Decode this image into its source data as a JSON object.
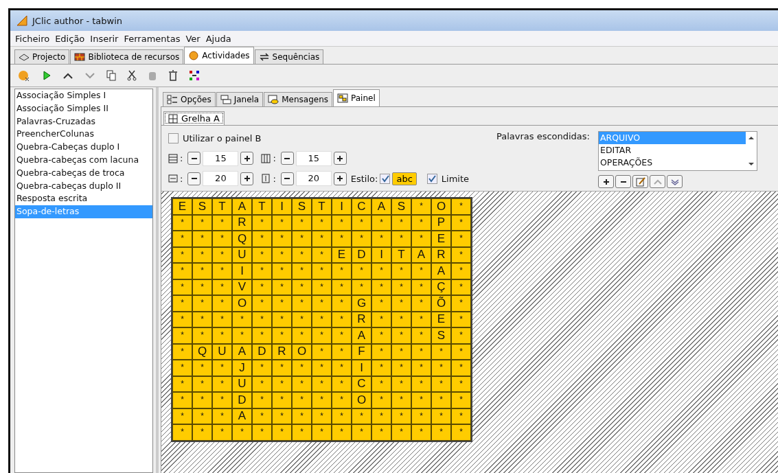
{
  "window": {
    "title": "JClic author - tabwin"
  },
  "menu": [
    "Ficheiro",
    "Edição",
    "Inserir",
    "Ferramentas",
    "Ver",
    "Ajuda"
  ],
  "tabs": [
    {
      "label": "Projecto",
      "selected": false
    },
    {
      "label": "Biblioteca de recursos",
      "selected": false
    },
    {
      "label": "Actividades",
      "selected": true
    },
    {
      "label": "Sequências",
      "selected": false
    }
  ],
  "activities": [
    {
      "label": "Associação Simples I",
      "selected": false
    },
    {
      "label": "Associação Simples II",
      "selected": false
    },
    {
      "label": "Palavras-Cruzadas",
      "selected": false
    },
    {
      "label": "PreencherColunas",
      "selected": false
    },
    {
      "label": "Quebra-Cabeças duplo I",
      "selected": false
    },
    {
      "label": "Quebra-cabeças com lacuna",
      "selected": false
    },
    {
      "label": "Quebra-cabeças de troca",
      "selected": false
    },
    {
      "label": "Quebra-cabeças duplo II",
      "selected": false
    },
    {
      "label": "Resposta escrita",
      "selected": false
    },
    {
      "label": "Sopa-de-letras",
      "selected": true
    }
  ],
  "editor_tabs": [
    {
      "label": "Opções",
      "selected": false
    },
    {
      "label": "Janela",
      "selected": false
    },
    {
      "label": "Mensagens",
      "selected": false
    },
    {
      "label": "Painel",
      "selected": true
    }
  ],
  "panel_tabs": [
    {
      "label": "Grelha A",
      "selected": true
    }
  ],
  "use_panel_b": {
    "label": "Utilizar o painel B",
    "checked": false
  },
  "spinners": [
    {
      "kind": "rows",
      "separator": ":",
      "value": "15"
    },
    {
      "kind": "columns",
      "separator": ":",
      "value": "15"
    },
    {
      "kind": "width",
      "separator": ":",
      "value": "20"
    },
    {
      "kind": "height",
      "separator": ":",
      "value": "20"
    }
  ],
  "style": {
    "label": "Estilo:",
    "checked": true,
    "sample": "abc"
  },
  "border": {
    "label": "Limite",
    "checked": true
  },
  "hidden_words": {
    "label": "Palavras escondidas:",
    "items": [
      {
        "label": "ARQUIVO",
        "selected": true
      },
      {
        "label": "EDITAR",
        "selected": false
      },
      {
        "label": "OPERAÇÕES",
        "selected": false
      }
    ]
  },
  "grid": {
    "rows": [
      [
        "E",
        "S",
        "T",
        "A",
        "T",
        "I",
        "S",
        "T",
        "I",
        "C",
        "A",
        "S",
        "*",
        "O",
        "*"
      ],
      [
        "*",
        "*",
        "*",
        "R",
        "*",
        "*",
        "*",
        "*",
        "*",
        "*",
        "*",
        "*",
        "*",
        "P",
        "*"
      ],
      [
        "*",
        "*",
        "*",
        "Q",
        "*",
        "*",
        "*",
        "*",
        "*",
        "*",
        "*",
        "*",
        "*",
        "E",
        "*"
      ],
      [
        "*",
        "*",
        "*",
        "U",
        "*",
        "*",
        "*",
        "*",
        "E",
        "D",
        "I",
        "T",
        "A",
        "R",
        "*"
      ],
      [
        "*",
        "*",
        "*",
        "I",
        "*",
        "*",
        "*",
        "*",
        "*",
        "*",
        "*",
        "*",
        "*",
        "A",
        "*"
      ],
      [
        "*",
        "*",
        "*",
        "V",
        "*",
        "*",
        "*",
        "*",
        "*",
        "*",
        "*",
        "*",
        "*",
        "Ç",
        "*"
      ],
      [
        "*",
        "*",
        "*",
        "O",
        "*",
        "*",
        "*",
        "*",
        "*",
        "G",
        "*",
        "*",
        "*",
        "Õ",
        "*"
      ],
      [
        "*",
        "*",
        "*",
        "*",
        "*",
        "*",
        "*",
        "*",
        "*",
        "R",
        "*",
        "*",
        "*",
        "E",
        "*"
      ],
      [
        "*",
        "*",
        "*",
        "*",
        "*",
        "*",
        "*",
        "*",
        "*",
        "A",
        "*",
        "*",
        "*",
        "S",
        "*"
      ],
      [
        "*",
        "Q",
        "U",
        "A",
        "D",
        "R",
        "O",
        "*",
        "*",
        "F",
        "*",
        "*",
        "*",
        "*",
        "*"
      ],
      [
        "*",
        "*",
        "*",
        "J",
        "*",
        "*",
        "*",
        "*",
        "*",
        "I",
        "*",
        "*",
        "*",
        "*",
        "*"
      ],
      [
        "*",
        "*",
        "*",
        "U",
        "*",
        "*",
        "*",
        "*",
        "*",
        "C",
        "*",
        "*",
        "*",
        "*",
        "*"
      ],
      [
        "*",
        "*",
        "*",
        "D",
        "*",
        "*",
        "*",
        "*",
        "*",
        "O",
        "*",
        "*",
        "*",
        "*",
        "*"
      ],
      [
        "*",
        "*",
        "*",
        "A",
        "*",
        "*",
        "*",
        "*",
        "*",
        "*",
        "*",
        "*",
        "*",
        "*",
        "*"
      ],
      [
        "*",
        "*",
        "*",
        "*",
        "*",
        "*",
        "*",
        "*",
        "*",
        "*",
        "*",
        "*",
        "*",
        "*",
        "*"
      ]
    ]
  }
}
